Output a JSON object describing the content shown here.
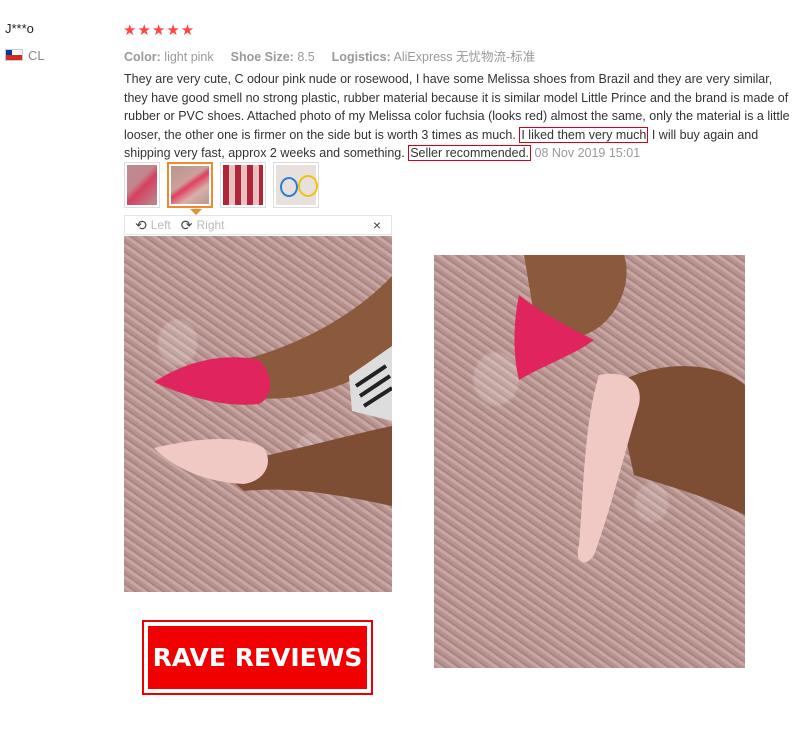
{
  "review": {
    "user": "J***o",
    "country": "CL",
    "rating_stars": 5,
    "stars_text": "★★★★★",
    "attributes": {
      "color_label": "Color:",
      "color_value": "light pink",
      "size_label": "Shoe Size:",
      "size_value": "8.5",
      "logistics_label": "Logistics:",
      "logistics_value": "AliExpress 无忧物流-标准"
    },
    "text_part1": "They are very cute, C odour pink nude or rosewood, I have some Melissa shoes from Brazil and they are very similar, they have good smell no strong plastic, rubber material because it is similar model Little Prince and the brand is made of rubber or PVC shoes. Attached photo of my Melissa color fuchsia (looks red) almost the same, only the material is a little looser, the other one is firmer on the side but is worth 3 times as much.",
    "highlight1": "I liked them very much",
    "text_part2": " I will buy again and shipping very fast, approx 2 weeks and something.",
    "highlight2": "Seller recommended.",
    "date": "08 Nov 2019 15:01"
  },
  "viewer": {
    "rotate_left_label": "Left",
    "rotate_right_label": "Right",
    "close_icon": "×"
  },
  "thumbnails": [
    {
      "name": "photo-1",
      "active": false
    },
    {
      "name": "photo-2",
      "active": true
    },
    {
      "name": "photo-3",
      "active": false
    },
    {
      "name": "photo-4",
      "active": false
    }
  ],
  "banner": {
    "text": "RAVE REVIEWS"
  },
  "colors": {
    "star": "#ff4444",
    "highlight_border": "#d0021b",
    "active_thumb": "#f08a2c",
    "banner_bg": "#f00000",
    "fuchsia_shoe": "#e0245e",
    "pink_shoe": "#f1c9c4"
  }
}
